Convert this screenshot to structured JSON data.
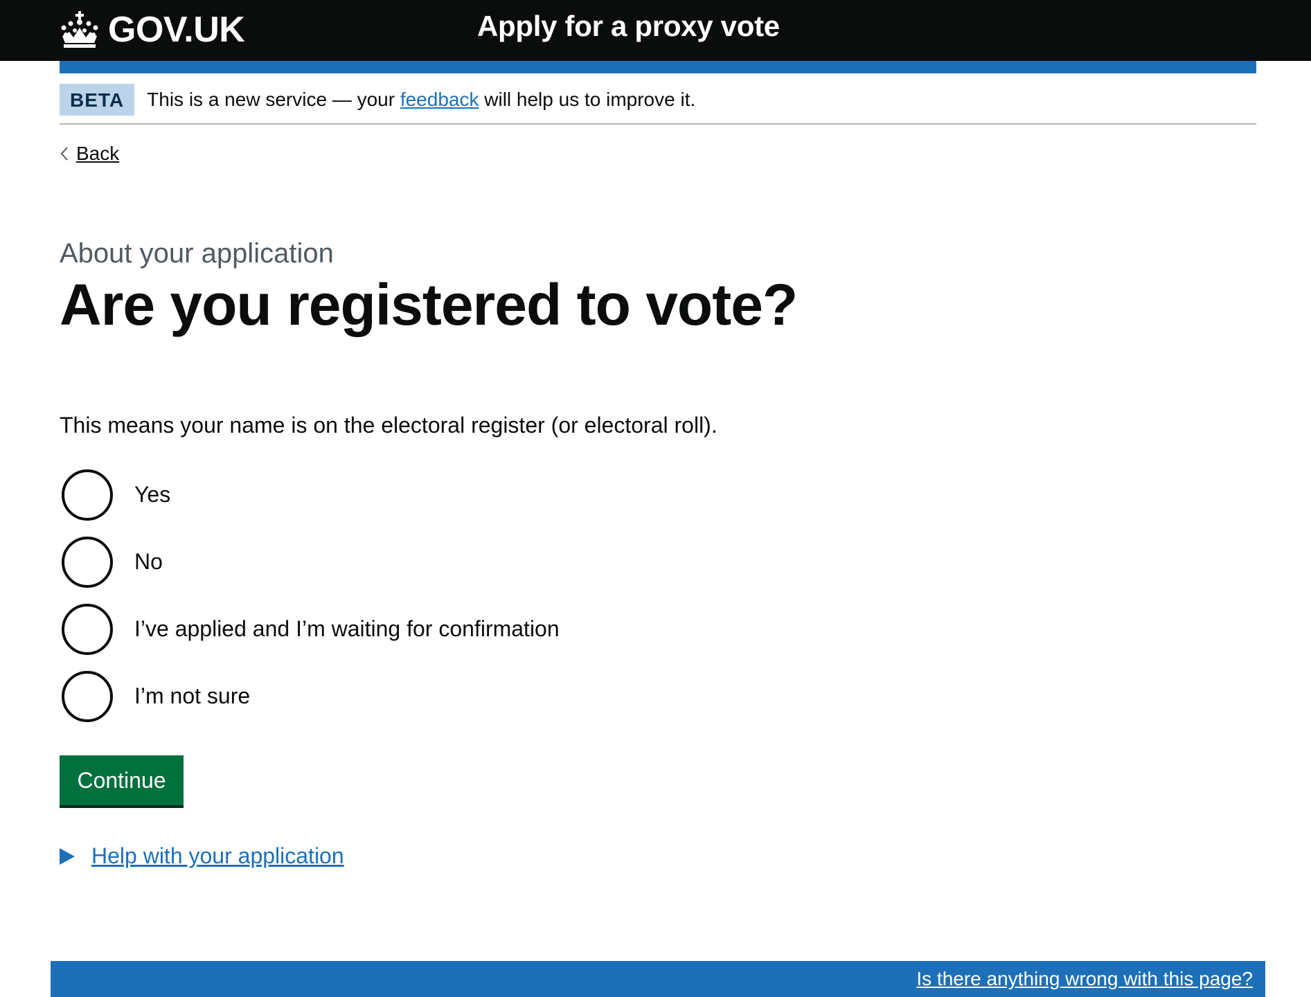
{
  "header": {
    "logo_text": "GOV.UK",
    "service_name": "Apply for a proxy vote"
  },
  "phase_banner": {
    "tag": "BETA",
    "text_before": "This is a new service — your ",
    "link_text": "feedback",
    "text_after": " will help us to improve it."
  },
  "back_link": {
    "label": "Back"
  },
  "main": {
    "caption": "About your application",
    "heading": "Are you registered to vote?",
    "hint": "This means your name is on the electoral register (or electoral roll).",
    "options": [
      {
        "label": "Yes",
        "selected": false
      },
      {
        "label": "No",
        "selected": false
      },
      {
        "label": "I’ve applied and I’m waiting for confirmation",
        "selected": false
      },
      {
        "label": "I’m not sure",
        "selected": false
      }
    ],
    "continue_label": "Continue",
    "details_summary": "Help with your application"
  },
  "footer": {
    "feedback_link": "Is there anything wrong with this page?"
  },
  "colors": {
    "header_bg": "#0b0c0c",
    "brand_blue": "#1d70b8",
    "button_green": "#00703c",
    "tag_bg": "#bbd4ea",
    "secondary_text": "#505a5f"
  },
  "icons": {
    "logo": "crown-icon",
    "back": "chevron-left-icon",
    "details": "triangle-right-icon"
  }
}
